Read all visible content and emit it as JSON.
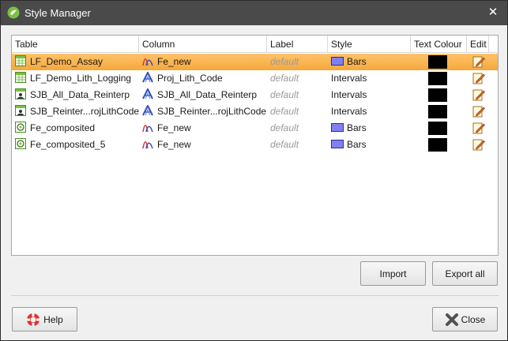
{
  "window": {
    "title": "Style Manager",
    "close_glyph": "✕"
  },
  "columns": [
    "Table",
    "Column",
    "Label",
    "Style",
    "Text Colour",
    "Edit"
  ],
  "rows": [
    {
      "table": "LF_Demo_Assay",
      "table_icon": "table-icon",
      "column": "Fe_new",
      "column_icon": "numeric-column-icon",
      "label": "default",
      "style": "Bars",
      "style_swatch": true,
      "text_colour": "#000000",
      "selected": true
    },
    {
      "table": "LF_Demo_Lith_Logging",
      "table_icon": "table-icon",
      "column": "Proj_Lith_Code",
      "column_icon": "category-column-icon",
      "label": "default",
      "style": "Intervals",
      "style_swatch": false,
      "text_colour": "#000000",
      "selected": false
    },
    {
      "table": "SJB_All_Data_Reinterp",
      "table_icon": "interpretation-table-icon",
      "column": "SJB_All_Data_Reinterp",
      "column_icon": "category-column-icon",
      "label": "default",
      "style": "Intervals",
      "style_swatch": false,
      "text_colour": "#000000",
      "selected": false
    },
    {
      "table": "SJB_Reinter...rojLithCode",
      "table_icon": "interpretation-table-icon",
      "column": "SJB_Reinter...rojLithCode",
      "column_icon": "category-column-icon",
      "label": "default",
      "style": "Intervals",
      "style_swatch": false,
      "text_colour": "#000000",
      "selected": false
    },
    {
      "table": "Fe_composited",
      "table_icon": "composite-table-icon",
      "column": "Fe_new",
      "column_icon": "numeric-column-icon",
      "label": "default",
      "style": "Bars",
      "style_swatch": true,
      "text_colour": "#000000",
      "selected": false
    },
    {
      "table": "Fe_composited_5",
      "table_icon": "composite-table-icon",
      "column": "Fe_new",
      "column_icon": "numeric-column-icon",
      "label": "default",
      "style": "Bars",
      "style_swatch": true,
      "text_colour": "#000000",
      "selected": false
    }
  ],
  "buttons": {
    "import_label": "Import",
    "export_label": "Export all",
    "help_label": "Help",
    "close_label": "Close"
  },
  "colors": {
    "selection": "#f4a83a",
    "bar_swatch": "#8080f0",
    "titlebar": "#4a4a4a"
  }
}
